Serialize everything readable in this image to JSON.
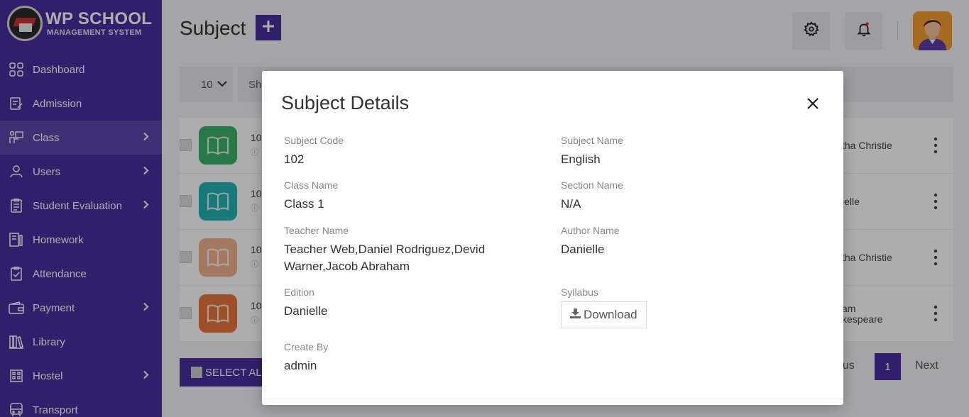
{
  "sidebar": {
    "logo_title": "WP SCHOOL",
    "logo_subtitle": "MANAGEMENT SYSTEM",
    "items": [
      {
        "label": "Dashboard",
        "icon": "dashboard-icon",
        "has_submenu": false
      },
      {
        "label": "Admission",
        "icon": "admission-icon",
        "has_submenu": false
      },
      {
        "label": "Class",
        "icon": "class-icon",
        "has_submenu": true,
        "active": true
      },
      {
        "label": "Users",
        "icon": "user-icon",
        "has_submenu": true
      },
      {
        "label": "Student Evaluation",
        "icon": "evaluation-icon",
        "has_submenu": true
      },
      {
        "label": "Homework",
        "icon": "homework-icon",
        "has_submenu": false
      },
      {
        "label": "Attendance",
        "icon": "attendance-icon",
        "has_submenu": false
      },
      {
        "label": "Payment",
        "icon": "wallet-icon",
        "has_submenu": true
      },
      {
        "label": "Library",
        "icon": "library-icon",
        "has_submenu": false
      },
      {
        "label": "Hostel",
        "icon": "hostel-icon",
        "has_submenu": true
      },
      {
        "label": "Transport",
        "icon": "bus-icon",
        "has_submenu": false
      }
    ]
  },
  "header": {
    "title": "Subject",
    "add_label": "+"
  },
  "list": {
    "page_length": "10",
    "search_prefix": "Sh",
    "rows": [
      {
        "code": "10",
        "teacher": "tha Christie",
        "color": "#3bb26b"
      },
      {
        "code": "10",
        "teacher": "ielle",
        "color": "#22b3b3"
      },
      {
        "code": "10",
        "teacher": "tha Christie",
        "color": "#f0b48e"
      },
      {
        "code": "10",
        "teacher": "am\nkespeare",
        "color": "#e8763a"
      }
    ],
    "select_all_label": "SELECT AL",
    "pagination": {
      "prev": "ous",
      "current": "1",
      "next": "Next"
    }
  },
  "modal": {
    "title": "Subject Details",
    "fields": {
      "subject_code": {
        "label": "Subject Code",
        "value": "102"
      },
      "subject_name": {
        "label": "Subject Name",
        "value": "English"
      },
      "class_name": {
        "label": "Class Name",
        "value": "Class 1"
      },
      "section_name": {
        "label": "Section Name",
        "value": "N/A"
      },
      "teacher_name": {
        "label": "Teacher Name",
        "value": "Teacher Web,Daniel Rodriguez,Devid Warner,Jacob Abraham"
      },
      "author_name": {
        "label": "Author Name",
        "value": "Danielle"
      },
      "edition": {
        "label": "Edition",
        "value": "Danielle"
      },
      "syllabus": {
        "label": "Syllabus",
        "button": "Download"
      },
      "create_by": {
        "label": "Create By",
        "value": "admin"
      }
    }
  },
  "colors": {
    "brand": "#4a2e9e",
    "sidebar_active": "#5e46ad"
  }
}
